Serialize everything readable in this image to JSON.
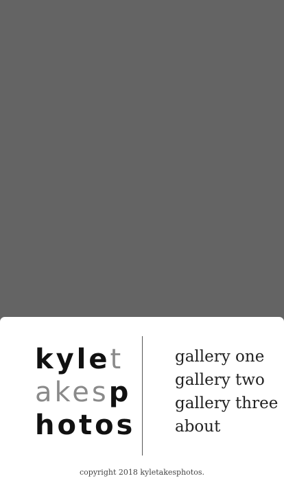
{
  "logo": {
    "line1_bold": "kyle",
    "line1_light": "t",
    "line2_light": "akes",
    "line2_bold": "p",
    "line3_bold": "hotos"
  },
  "nav": {
    "items": [
      {
        "label": "gallery one"
      },
      {
        "label": "gallery two"
      },
      {
        "label": "gallery three"
      },
      {
        "label": "about"
      }
    ]
  },
  "footer": {
    "copyright": "copyright 2018 kyletakesphotos."
  },
  "colors": {
    "background": "#646464",
    "panel": "#ffffff",
    "text_dark": "#111111",
    "text_light": "#8a8a8a"
  }
}
